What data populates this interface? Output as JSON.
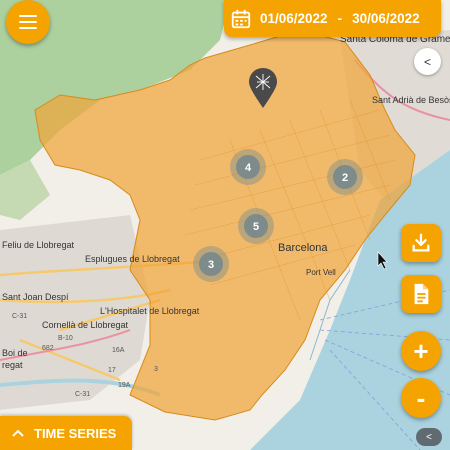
{
  "toolbar": {
    "menu_icon": "hamburger-menu-icon",
    "calendar_icon": "calendar-icon",
    "date_from": "01/06/2022",
    "date_separator": "-",
    "date_to": "30/06/2022"
  },
  "side_panel": {
    "collapse_label": "<",
    "download_icon": "download-icon",
    "report_icon": "document-icon",
    "zoom_in_label": "+",
    "zoom_out_label": "-"
  },
  "bottom": {
    "time_series_label": "TIME SERIES",
    "chevron_icon": "chevron-up-icon",
    "corner_tab_label": "<"
  },
  "map": {
    "marker_icon": "mosquito-pin-icon",
    "clusters": [
      {
        "count": "4"
      },
      {
        "count": "2"
      },
      {
        "count": "5"
      },
      {
        "count": "3"
      }
    ],
    "place_labels": [
      "Santa Coloma de Gramenet",
      "Sant Adrià de Besòs",
      "Barcelona",
      "Port Vell",
      "Esplugues de Llobregat",
      "Feliu de Llobregat",
      "Sant Joan Despí",
      "L'Hospitalet de Llobregat",
      "Cornellà de Llobregat",
      "Boi de",
      "regat"
    ],
    "road_labels": [
      "C-31",
      "B-10",
      "16A",
      "17",
      "19A",
      "3",
      "682",
      "C-31"
    ],
    "colors": {
      "accent": "#f5a300",
      "area_fill": "#f0a53a",
      "cluster": "#7d8b8b",
      "sea": "#aad3df",
      "land": "#f2efe9",
      "forest": "#add19e"
    }
  }
}
